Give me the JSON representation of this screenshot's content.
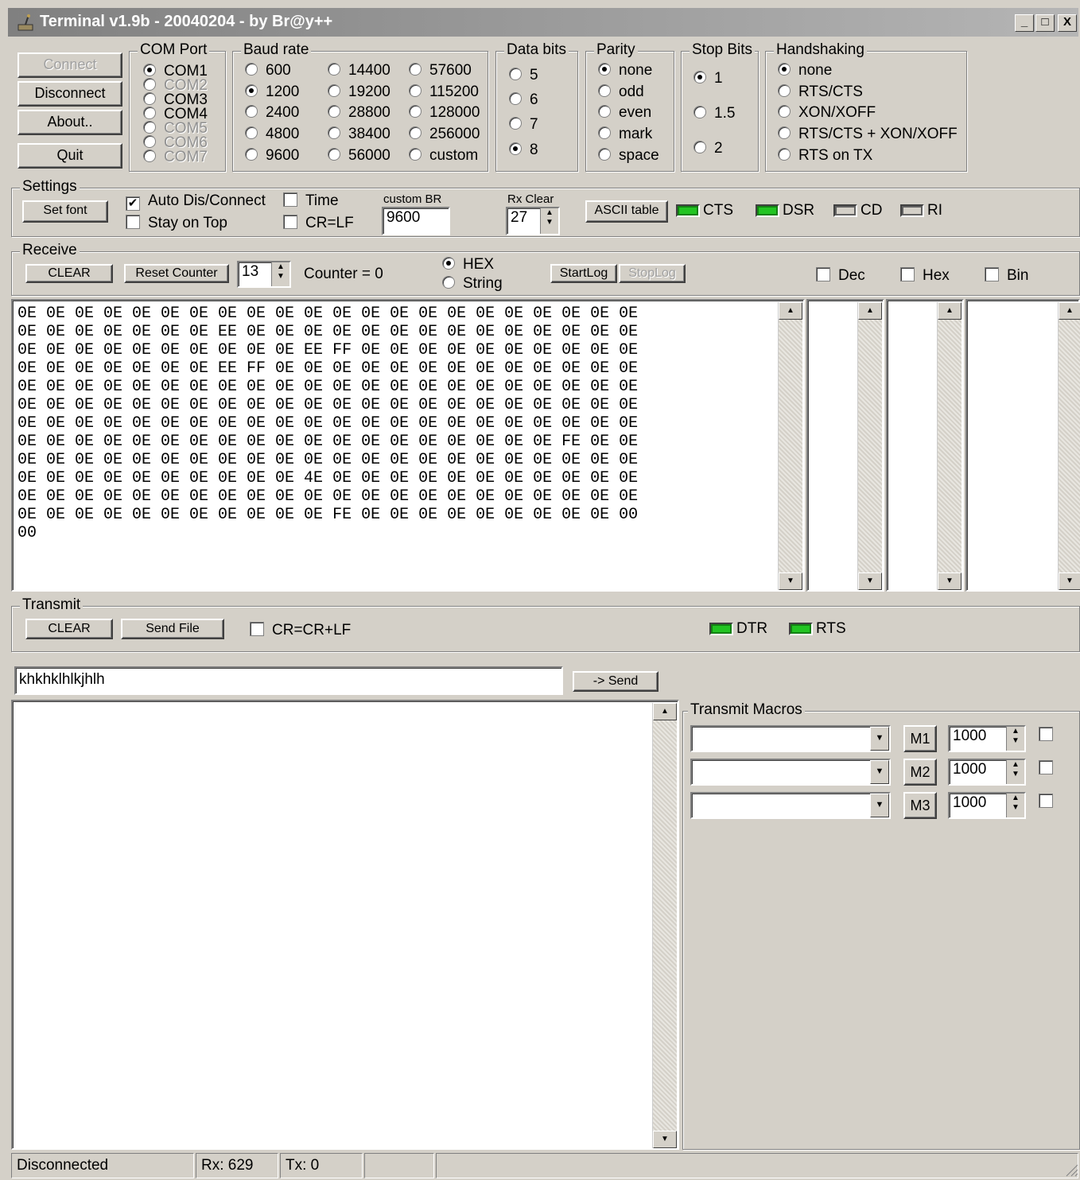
{
  "window": {
    "title": "Terminal v1.9b - 20040204 - by Br@y++",
    "minimize": "_",
    "maximize": "□",
    "close": "X"
  },
  "buttons": {
    "connect": "Connect",
    "disconnect": "Disconnect",
    "about": "About..",
    "quit": "Quit"
  },
  "com_port": {
    "label": "COM Port",
    "options": [
      "COM1",
      "COM2",
      "COM3",
      "COM4",
      "COM5",
      "COM6",
      "COM7"
    ],
    "selected": "COM1"
  },
  "baud_rate": {
    "label": "Baud rate",
    "options": [
      "600",
      "1200",
      "2400",
      "4800",
      "9600",
      "14400",
      "19200",
      "28800",
      "38400",
      "56000",
      "57600",
      "115200",
      "128000",
      "256000",
      "custom"
    ],
    "selected": "1200"
  },
  "data_bits": {
    "label": "Data bits",
    "options": [
      "5",
      "6",
      "7",
      "8"
    ],
    "selected": "8"
  },
  "parity": {
    "label": "Parity",
    "options": [
      "none",
      "odd",
      "even",
      "mark",
      "space"
    ],
    "selected": "none"
  },
  "stop_bits": {
    "label": "Stop Bits",
    "options": [
      "1",
      "1.5",
      "2"
    ],
    "selected": "1"
  },
  "handshaking": {
    "label": "Handshaking",
    "options": [
      "none",
      "RTS/CTS",
      "XON/XOFF",
      "RTS/CTS + XON/XOFF",
      "RTS on TX"
    ],
    "selected": "none"
  },
  "settings": {
    "label": "Settings",
    "set_font": "Set font",
    "auto_dis_connect": "Auto Dis/Connect",
    "auto_dis_connect_checked": true,
    "stay_on_top": "Stay on Top",
    "time": "Time",
    "cr_lf": "CR=LF",
    "custom_br_label": "custom BR",
    "custom_br_value": "9600",
    "rx_clear_label": "Rx Clear",
    "rx_clear_value": "27",
    "ascii_table": "ASCII table",
    "cts": "CTS",
    "dsr": "DSR",
    "cd": "CD",
    "ri": "RI"
  },
  "receive": {
    "label": "Receive",
    "clear": "CLEAR",
    "reset_counter": "Reset Counter",
    "counter_spin": "13",
    "counter_text": "Counter = 0",
    "hex": "HEX",
    "string": "String",
    "start_log": "StartLog",
    "stop_log": "StopLog",
    "dec": "Dec",
    "hex_chk": "Hex",
    "bin": "Bin",
    "data_lines": [
      "0E 0E 0E 0E 0E 0E 0E 0E 0E 0E 0E 0E 0E 0E 0E 0E 0E 0E 0E 0E 0E 0E",
      "0E 0E 0E 0E 0E 0E 0E EE 0E 0E 0E 0E 0E 0E 0E 0E 0E 0E 0E 0E 0E 0E",
      "0E 0E 0E 0E 0E 0E 0E 0E 0E 0E EE FF 0E 0E 0E 0E 0E 0E 0E 0E 0E 0E",
      "0E 0E 0E 0E 0E 0E 0E EE FF 0E 0E 0E 0E 0E 0E 0E 0E 0E 0E 0E 0E 0E",
      "0E 0E 0E 0E 0E 0E 0E 0E 0E 0E 0E 0E 0E 0E 0E 0E 0E 0E 0E 0E 0E 0E",
      "0E 0E 0E 0E 0E 0E 0E 0E 0E 0E 0E 0E 0E 0E 0E 0E 0E 0E 0E 0E 0E 0E",
      "0E 0E 0E 0E 0E 0E 0E 0E 0E 0E 0E 0E 0E 0E 0E 0E 0E 0E 0E 0E 0E 0E",
      "0E 0E 0E 0E 0E 0E 0E 0E 0E 0E 0E 0E 0E 0E 0E 0E 0E 0E 0E FE 0E 0E",
      "0E 0E 0E 0E 0E 0E 0E 0E 0E 0E 0E 0E 0E 0E 0E 0E 0E 0E 0E 0E 0E 0E",
      "0E 0E 0E 0E 0E 0E 0E 0E 0E 0E 4E 0E 0E 0E 0E 0E 0E 0E 0E 0E 0E 0E",
      "0E 0E 0E 0E 0E 0E 0E 0E 0E 0E 0E 0E 0E 0E 0E 0E 0E 0E 0E 0E 0E 0E",
      "0E 0E 0E 0E 0E 0E 0E 0E 0E 0E 0E FE 0E 0E 0E 0E 0E 0E 0E 0E 0E 00",
      "00"
    ]
  },
  "transmit": {
    "label": "Transmit",
    "clear": "CLEAR",
    "send_file": "Send File",
    "cr_crlf": "CR=CR+LF",
    "dtr": "DTR",
    "rts": "RTS",
    "input_value": "khkhklhlkjhlh",
    "send": "-> Send"
  },
  "macros": {
    "label": "Transmit Macros",
    "items": [
      {
        "button": "M1",
        "interval": "1000"
      },
      {
        "button": "M2",
        "interval": "1000"
      },
      {
        "button": "M3",
        "interval": "1000"
      }
    ]
  },
  "status": {
    "state": "Disconnected",
    "rx": "Rx: 629",
    "tx": "Tx: 0"
  },
  "colors": {
    "led_on": "#22c422",
    "window_bg": "#d4d0c8",
    "titlebar": "#808080"
  }
}
